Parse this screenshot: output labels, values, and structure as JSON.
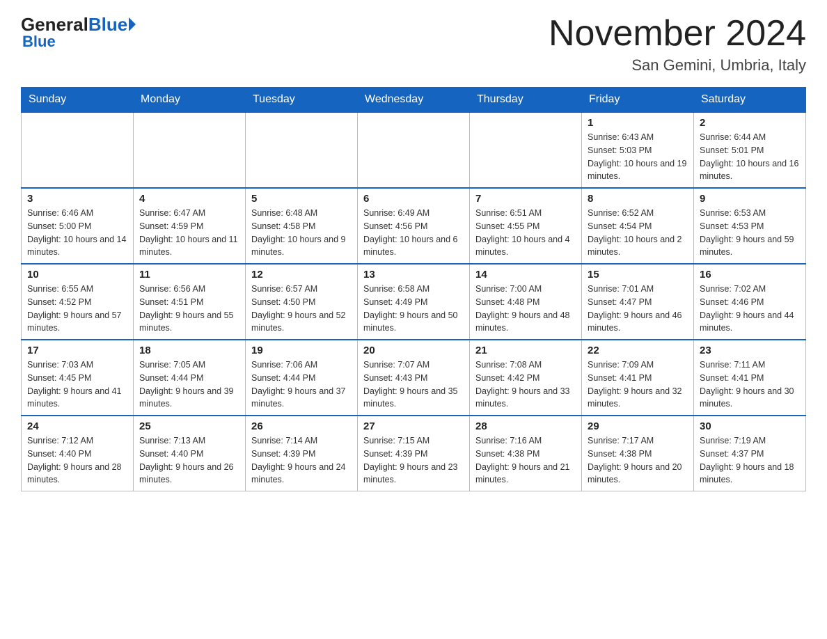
{
  "header": {
    "logo_general": "General",
    "logo_blue": "Blue",
    "main_title": "November 2024",
    "subtitle": "San Gemini, Umbria, Italy"
  },
  "days_of_week": [
    "Sunday",
    "Monday",
    "Tuesday",
    "Wednesday",
    "Thursday",
    "Friday",
    "Saturday"
  ],
  "weeks": [
    [
      {
        "day": "",
        "info": ""
      },
      {
        "day": "",
        "info": ""
      },
      {
        "day": "",
        "info": ""
      },
      {
        "day": "",
        "info": ""
      },
      {
        "day": "",
        "info": ""
      },
      {
        "day": "1",
        "info": "Sunrise: 6:43 AM\nSunset: 5:03 PM\nDaylight: 10 hours and 19 minutes."
      },
      {
        "day": "2",
        "info": "Sunrise: 6:44 AM\nSunset: 5:01 PM\nDaylight: 10 hours and 16 minutes."
      }
    ],
    [
      {
        "day": "3",
        "info": "Sunrise: 6:46 AM\nSunset: 5:00 PM\nDaylight: 10 hours and 14 minutes."
      },
      {
        "day": "4",
        "info": "Sunrise: 6:47 AM\nSunset: 4:59 PM\nDaylight: 10 hours and 11 minutes."
      },
      {
        "day": "5",
        "info": "Sunrise: 6:48 AM\nSunset: 4:58 PM\nDaylight: 10 hours and 9 minutes."
      },
      {
        "day": "6",
        "info": "Sunrise: 6:49 AM\nSunset: 4:56 PM\nDaylight: 10 hours and 6 minutes."
      },
      {
        "day": "7",
        "info": "Sunrise: 6:51 AM\nSunset: 4:55 PM\nDaylight: 10 hours and 4 minutes."
      },
      {
        "day": "8",
        "info": "Sunrise: 6:52 AM\nSunset: 4:54 PM\nDaylight: 10 hours and 2 minutes."
      },
      {
        "day": "9",
        "info": "Sunrise: 6:53 AM\nSunset: 4:53 PM\nDaylight: 9 hours and 59 minutes."
      }
    ],
    [
      {
        "day": "10",
        "info": "Sunrise: 6:55 AM\nSunset: 4:52 PM\nDaylight: 9 hours and 57 minutes."
      },
      {
        "day": "11",
        "info": "Sunrise: 6:56 AM\nSunset: 4:51 PM\nDaylight: 9 hours and 55 minutes."
      },
      {
        "day": "12",
        "info": "Sunrise: 6:57 AM\nSunset: 4:50 PM\nDaylight: 9 hours and 52 minutes."
      },
      {
        "day": "13",
        "info": "Sunrise: 6:58 AM\nSunset: 4:49 PM\nDaylight: 9 hours and 50 minutes."
      },
      {
        "day": "14",
        "info": "Sunrise: 7:00 AM\nSunset: 4:48 PM\nDaylight: 9 hours and 48 minutes."
      },
      {
        "day": "15",
        "info": "Sunrise: 7:01 AM\nSunset: 4:47 PM\nDaylight: 9 hours and 46 minutes."
      },
      {
        "day": "16",
        "info": "Sunrise: 7:02 AM\nSunset: 4:46 PM\nDaylight: 9 hours and 44 minutes."
      }
    ],
    [
      {
        "day": "17",
        "info": "Sunrise: 7:03 AM\nSunset: 4:45 PM\nDaylight: 9 hours and 41 minutes."
      },
      {
        "day": "18",
        "info": "Sunrise: 7:05 AM\nSunset: 4:44 PM\nDaylight: 9 hours and 39 minutes."
      },
      {
        "day": "19",
        "info": "Sunrise: 7:06 AM\nSunset: 4:44 PM\nDaylight: 9 hours and 37 minutes."
      },
      {
        "day": "20",
        "info": "Sunrise: 7:07 AM\nSunset: 4:43 PM\nDaylight: 9 hours and 35 minutes."
      },
      {
        "day": "21",
        "info": "Sunrise: 7:08 AM\nSunset: 4:42 PM\nDaylight: 9 hours and 33 minutes."
      },
      {
        "day": "22",
        "info": "Sunrise: 7:09 AM\nSunset: 4:41 PM\nDaylight: 9 hours and 32 minutes."
      },
      {
        "day": "23",
        "info": "Sunrise: 7:11 AM\nSunset: 4:41 PM\nDaylight: 9 hours and 30 minutes."
      }
    ],
    [
      {
        "day": "24",
        "info": "Sunrise: 7:12 AM\nSunset: 4:40 PM\nDaylight: 9 hours and 28 minutes."
      },
      {
        "day": "25",
        "info": "Sunrise: 7:13 AM\nSunset: 4:40 PM\nDaylight: 9 hours and 26 minutes."
      },
      {
        "day": "26",
        "info": "Sunrise: 7:14 AM\nSunset: 4:39 PM\nDaylight: 9 hours and 24 minutes."
      },
      {
        "day": "27",
        "info": "Sunrise: 7:15 AM\nSunset: 4:39 PM\nDaylight: 9 hours and 23 minutes."
      },
      {
        "day": "28",
        "info": "Sunrise: 7:16 AM\nSunset: 4:38 PM\nDaylight: 9 hours and 21 minutes."
      },
      {
        "day": "29",
        "info": "Sunrise: 7:17 AM\nSunset: 4:38 PM\nDaylight: 9 hours and 20 minutes."
      },
      {
        "day": "30",
        "info": "Sunrise: 7:19 AM\nSunset: 4:37 PM\nDaylight: 9 hours and 18 minutes."
      }
    ]
  ]
}
